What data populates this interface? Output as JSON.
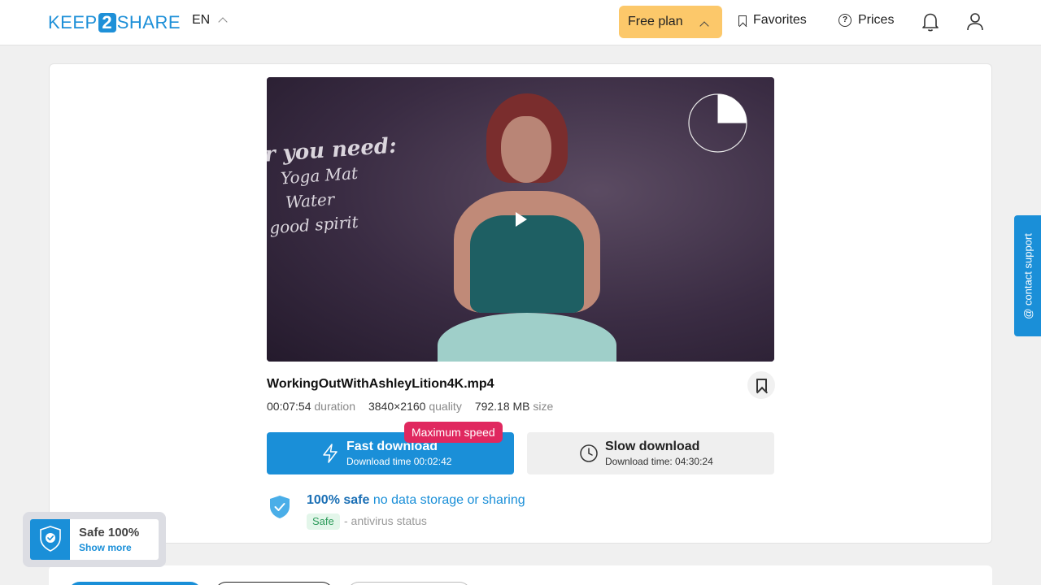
{
  "header": {
    "logo_left": "KEEP",
    "logo_mid": "2",
    "logo_right": "SHARE",
    "language": "EN",
    "plan_label": "Free plan",
    "favorites_label": "Favorites",
    "prices_label": "Prices"
  },
  "video": {
    "wall_text_line1": "r you need:",
    "wall_text_line2": "Yoga Mat",
    "wall_text_line3": "Water",
    "wall_text_line4": "good spirit",
    "timer_progress": 0.25
  },
  "file": {
    "name": "WorkingOutWithAshleyLition4K.mp4",
    "duration_value": "00:07:54",
    "duration_label": "duration",
    "quality_value": "3840×2160",
    "quality_label": "quality",
    "size_value": "792.18 MB",
    "size_label": "size"
  },
  "download": {
    "badge": "Maximum speed",
    "fast_title": "Fast download",
    "fast_time": "Download time 00:02:42",
    "slow_title": "Slow download",
    "slow_time": "Download time: 04:30:24"
  },
  "safety": {
    "bold": "100% safe",
    "rest": " no data storage or sharing",
    "tag": "Safe",
    "status": "- antivirus status"
  },
  "support_label": "@ contact support",
  "safe_widget": {
    "title": "Safe 100%",
    "link": "Show more"
  },
  "colors": {
    "brand_blue": "#1a8fd8",
    "plan_yellow": "#fcc86a",
    "badge_red": "#e0285f"
  }
}
